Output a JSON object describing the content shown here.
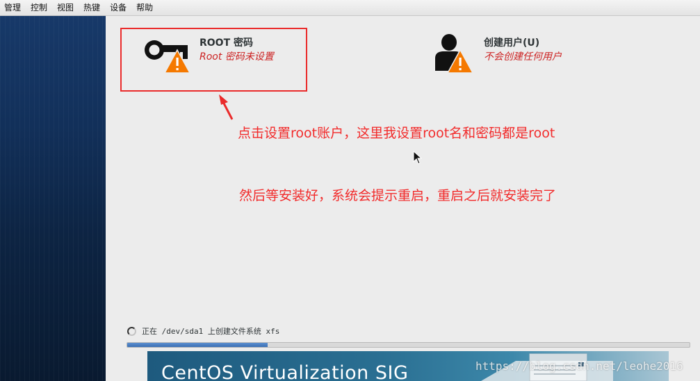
{
  "menubar": {
    "items": [
      "管理",
      "控制",
      "视图",
      "热键",
      "设备",
      "帮助"
    ]
  },
  "spokes": {
    "root": {
      "title": "ROOT 密码",
      "status": "Root 密码未设置",
      "icon": "key-warning-icon"
    },
    "user": {
      "title": "创建用户(U)",
      "status": "不会创建任何用户",
      "icon": "user-warning-icon"
    }
  },
  "annotations": {
    "line1": "点击设置root账户，这里我设置root名和密码都是root",
    "line2": "然后等安装好，系统会提示重启，重启之后就安装完了"
  },
  "progress": {
    "status_text": "正在 /dev/sda1 上创建文件系统 xfs",
    "value_percent": 25
  },
  "banner": {
    "text": "CentOS Virtualization SIG"
  },
  "watermark": {
    "text": "https://blog.csdn.net/leohe2016"
  },
  "colors": {
    "annotation_red": "#f22b2b",
    "status_red": "#cc2222",
    "warning_orange": "#f57900",
    "progress_blue": "#3a6fb4"
  }
}
